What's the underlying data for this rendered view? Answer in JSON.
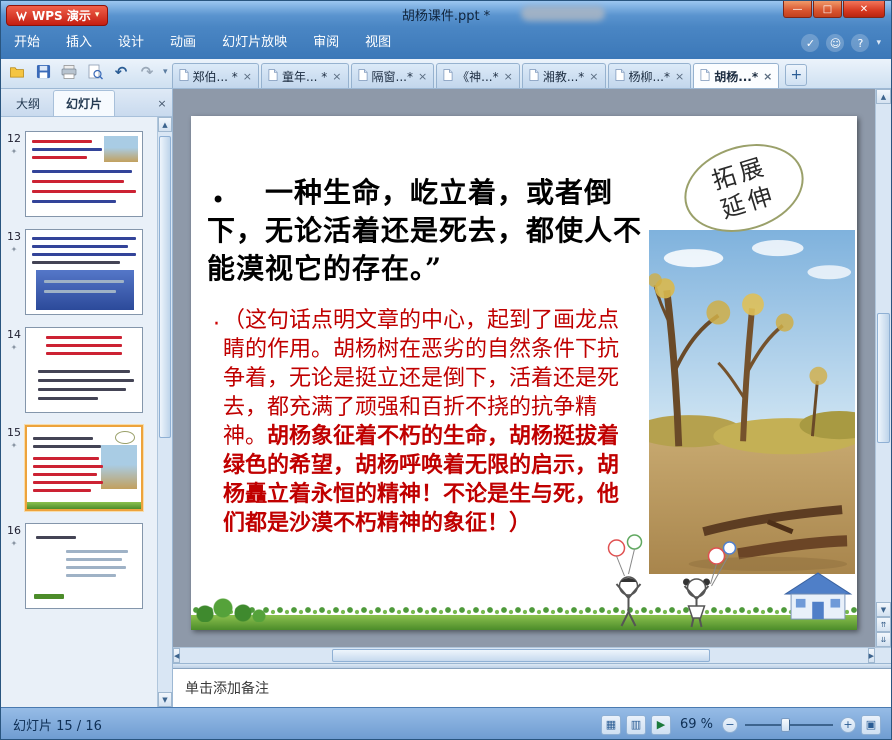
{
  "window": {
    "app_button": "WPS 演示",
    "title": "胡杨课件.ppt *"
  },
  "glyphs": {
    "dropdown": "▾",
    "minimize": "—",
    "maximize": "□",
    "close": "✕",
    "tab_close": "×",
    "panel_close": "×",
    "add_tab": "+",
    "undo": "↶",
    "redo": "↷",
    "arrow_up": "▲",
    "arrow_down": "▼",
    "arrow_left": "◀",
    "arrow_right": "▶",
    "prev_slide": "⇈",
    "next_slide": "⇊",
    "anim_star": "✦",
    "bullet": "•",
    "red_bullet": "·",
    "check": "✓",
    "smiley": "☺",
    "help": "?",
    "view_normal": "▦",
    "view_sorter": "▥",
    "view_play": "▶",
    "zoom_minus": "−",
    "zoom_plus": "+",
    "fit": "▣"
  },
  "menu": {
    "items": [
      "开始",
      "插入",
      "设计",
      "动画",
      "幻灯片放映",
      "审阅",
      "视图"
    ]
  },
  "doc_tabs": {
    "tabs": [
      {
        "label": "郑伯... *"
      },
      {
        "label": "童年... *"
      },
      {
        "label": "隔窗...*"
      },
      {
        "label": "《神...*"
      },
      {
        "label": "湘教...*"
      },
      {
        "label": "杨柳...*"
      },
      {
        "label": "胡杨...*"
      }
    ]
  },
  "panel": {
    "outline_tab": "大纲",
    "slides_tab": "幻灯片",
    "thumbs": [
      {
        "number": "12"
      },
      {
        "number": "13"
      },
      {
        "number": "14"
      },
      {
        "number": "15"
      },
      {
        "number": "16"
      }
    ]
  },
  "slide": {
    "body_text": "一种生命，屹立着，或者倒下，无论活着还是死去，都使人不能漠视它的存在。”",
    "red_text_normal": "（这句话点明文章的中心，起到了画龙点睛的作用。胡杨树在恶劣的自然条件下抗争着，无论是挺立还是倒下，活着还是死去，都充满了顽强和百折不挠的抗争精神。",
    "red_text_bold": "胡杨象征着不朽的生命，胡杨挺拔着绿色的希望，胡杨呼唤着无限的启示，胡杨矗立着永恒的精神！不论是生与死，他们都是沙漠不朽精神的象征！）",
    "badge_line1": "拓展",
    "badge_line2": "延伸"
  },
  "notes": {
    "placeholder": "单击添加备注"
  },
  "statusbar": {
    "slide_counter": "幻灯片 15 / 16",
    "zoom_level": "69 %"
  },
  "colors": {
    "titlebar_blue": "#4a86c4",
    "wps_red": "#d13426",
    "accent_red": "#cc0000",
    "selected_thumb_border": "#eda33c",
    "canvas_gray": "#8e99a9"
  }
}
